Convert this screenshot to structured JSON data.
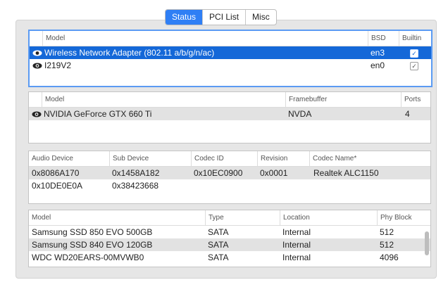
{
  "tabs": [
    {
      "label": "Status",
      "active": true
    },
    {
      "label": "PCI List",
      "active": false
    },
    {
      "label": "Misc",
      "active": false
    }
  ],
  "network": {
    "headers": {
      "model": "Model",
      "bsd": "BSD",
      "builtin": "Builtin"
    },
    "rows": [
      {
        "model": "Wireless Network Adapter (802.11 a/b/g/n/ac)",
        "bsd": "en3",
        "builtin": true,
        "selected": true
      },
      {
        "model": "I219V2",
        "bsd": "en0",
        "builtin": true,
        "selected": false
      }
    ]
  },
  "graphics": {
    "headers": {
      "model": "Model",
      "framebuffer": "Framebuffer",
      "ports": "Ports"
    },
    "rows": [
      {
        "model": "NVIDIA GeForce GTX 660 Ti",
        "framebuffer": "NVDA",
        "ports": "4"
      }
    ]
  },
  "audio": {
    "headers": {
      "audio_device": "Audio Device",
      "sub_device": "Sub Device",
      "codec_id": "Codec ID",
      "revision": "Revision",
      "codec_name": "Codec Name*"
    },
    "rows": [
      {
        "audio_device": "0x8086A170",
        "sub_device": "0x1458A182",
        "codec_id": "0x10EC0900",
        "revision": "0x0001",
        "codec_name": "Realtek ALC1150"
      },
      {
        "audio_device": "0x10DE0E0A",
        "sub_device": "0x38423668",
        "codec_id": "",
        "revision": "",
        "codec_name": ""
      }
    ]
  },
  "storage": {
    "headers": {
      "model": "Model",
      "type": "Type",
      "location": "Location",
      "phy_block": "Phy Block"
    },
    "rows": [
      {
        "model": "Samsung SSD 850 EVO 500GB",
        "type": "SATA",
        "location": "Internal",
        "phy_block": "512"
      },
      {
        "model": "Samsung SSD 840 EVO 120GB",
        "type": "SATA",
        "location": "Internal",
        "phy_block": "512"
      },
      {
        "model": "WDC WD20EARS-00MVWB0",
        "type": "SATA",
        "location": "Internal",
        "phy_block": "4096"
      }
    ]
  },
  "icons": {
    "visible": "eye-icon",
    "check": "checkmark-icon"
  },
  "colors": {
    "tab_active": "#2f7ff5",
    "selection": "#1468d8",
    "focus_ring": "#5b9bf3"
  }
}
